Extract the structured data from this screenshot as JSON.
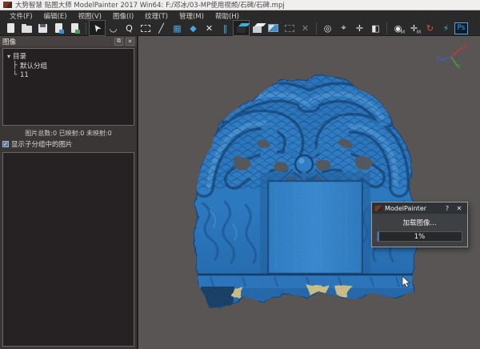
{
  "window": {
    "title": "大势智慧 贴图大师 ModelPainter 2017 Win64: F:/邓冰/03-MP使用视频/石碑/石碑.mpj"
  },
  "menu": {
    "items": [
      {
        "label": "文件(F)"
      },
      {
        "label": "编辑(E)"
      },
      {
        "label": "视图(V)"
      },
      {
        "label": "图像(I)"
      },
      {
        "label": "纹理(T)"
      },
      {
        "label": "管理(M)"
      },
      {
        "label": "帮助(H)"
      }
    ]
  },
  "toolbar": {
    "icons": [
      {
        "name": "new-file",
        "glyph": ""
      },
      {
        "name": "open-folder",
        "glyph": ""
      },
      {
        "name": "save",
        "glyph": ""
      },
      {
        "name": "import-image",
        "glyph": ""
      },
      {
        "name": "export-image",
        "glyph": ""
      },
      {
        "name": "select-arrow",
        "glyph": "➤",
        "state": "pressed"
      },
      {
        "name": "lasso-select",
        "glyph": "◡"
      },
      {
        "name": "loop-select",
        "glyph": "Q"
      },
      {
        "name": "marquee-select",
        "glyph": ""
      },
      {
        "name": "line-tool",
        "glyph": "╱"
      },
      {
        "name": "paste-region",
        "glyph": "▦"
      },
      {
        "name": "shield-mesh",
        "glyph": "◆"
      },
      {
        "name": "delete-red",
        "glyph": "✕"
      },
      {
        "name": "stripes-blend",
        "glyph": "‖"
      },
      {
        "name": "cube-dark",
        "glyph": "",
        "state": "pressed"
      },
      {
        "name": "cube-light",
        "glyph": ""
      },
      {
        "name": "photo-view",
        "glyph": ""
      },
      {
        "name": "marquee-disabled",
        "glyph": "",
        "state": "disabled"
      },
      {
        "name": "clear-disabled",
        "glyph": "✕",
        "state": "disabled"
      },
      {
        "name": "target-circle",
        "glyph": "◎"
      },
      {
        "name": "target-frame",
        "glyph": "⌖"
      },
      {
        "name": "move-cross",
        "glyph": "✛"
      },
      {
        "name": "split-panel",
        "glyph": "◧"
      },
      {
        "name": "camera-map",
        "glyph": "◉",
        "sub": "M"
      },
      {
        "name": "move-map",
        "glyph": "✛",
        "sub": "M"
      },
      {
        "name": "refresh-sync",
        "glyph": "↻"
      },
      {
        "name": "lightning-bake",
        "glyph": "⚡"
      },
      {
        "name": "photoshop-link",
        "glyph": "Ps"
      }
    ]
  },
  "left_panel": {
    "header": {
      "title": "图像",
      "float_button": "⧉",
      "close_button": "✕"
    },
    "tree": {
      "root_arrow": "▾",
      "root": "目录",
      "child1_branch": "├",
      "child1": "默认分组",
      "child2_branch": "└",
      "child2": "11"
    },
    "stats": "图片总数:0 已映射:0 未映射:0",
    "checkbox": {
      "checked_mark": "✓",
      "label": "显示子分组中的图片"
    }
  },
  "viewport": {
    "axis": {
      "x_label": "X",
      "y_label": "Y",
      "z_label": "Z",
      "x_color": "#c43b31",
      "y_color": "#3f9e3f",
      "z_color": "#3a5fc8"
    },
    "model": {
      "name": "stone-stele-dragon-scan",
      "base_color": "#2c7cc8"
    }
  },
  "dialog": {
    "title": "ModelPainter",
    "help_button": "?",
    "close_button": "✕",
    "message": "加载图像...",
    "progress_label": "1%",
    "progress_percent": 1
  },
  "colors": {
    "viewport_bg": "#585554",
    "ui_dark": "#2b2a2a",
    "panel_bg": "#3a3636",
    "model_blue": "#2c7cc8",
    "model_shadow": "#15477e",
    "untextured_yellow": "#e2cc82"
  }
}
